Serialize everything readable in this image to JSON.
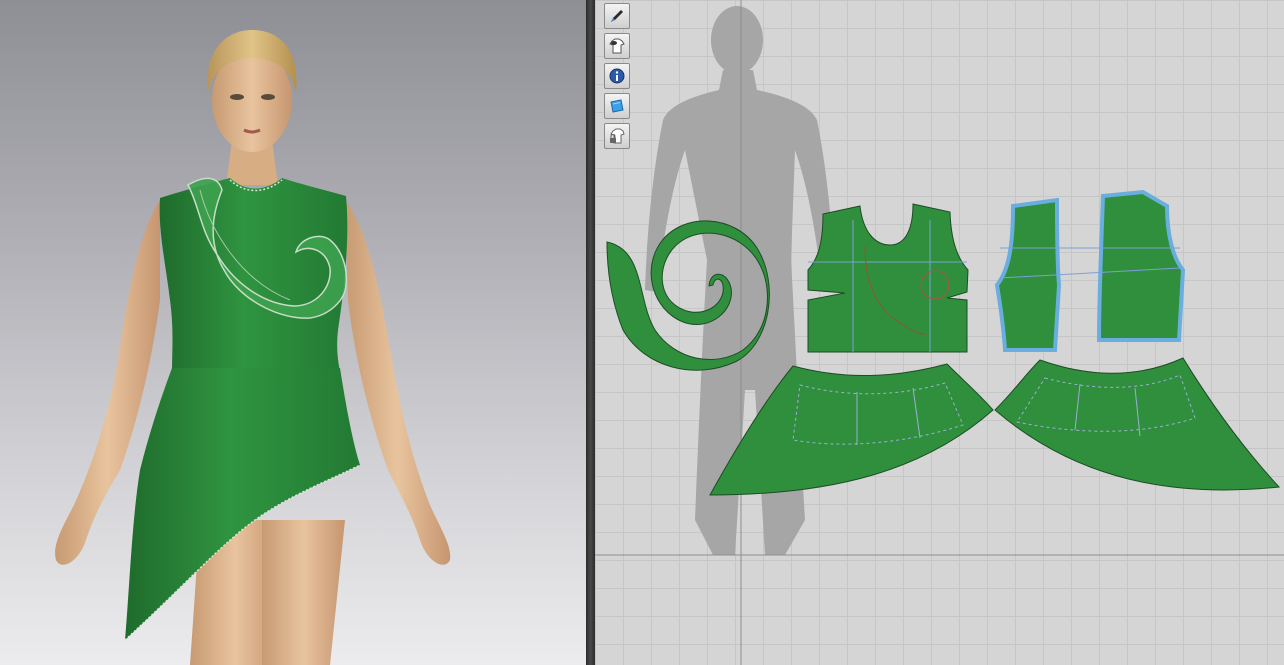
{
  "app": {
    "panels": [
      "3d-garment-window",
      "2d-pattern-window"
    ]
  },
  "toolbar2d": {
    "tools": [
      {
        "name": "edit-pattern-tool",
        "icon": "pen-icon"
      },
      {
        "name": "show-garment-tool",
        "icon": "shirt-eye-icon"
      },
      {
        "name": "show-info-tool",
        "icon": "info-icon"
      },
      {
        "name": "show-texture-tool",
        "icon": "fabric-swatch-icon"
      },
      {
        "name": "lock-garment-tool",
        "icon": "shirt-lock-icon"
      }
    ]
  },
  "colors": {
    "fabric": "#2e8b3c",
    "fabric_dark": "#1f6b2c",
    "pattern_fill": "#2f8f3d",
    "selected_outline": "#6aaee0",
    "grid": "#c6c6c6",
    "canvas_bg": "#d5d5d5",
    "avatar_silhouette": "#a5a5a5"
  },
  "patterns": {
    "spiral": "ruffle-spiral",
    "front_bodice": "front-bodice",
    "back_bodice": "back-bodice-selected",
    "front_skirt": "front-peplum-skirt",
    "back_skirt": "back-peplum-skirt"
  }
}
